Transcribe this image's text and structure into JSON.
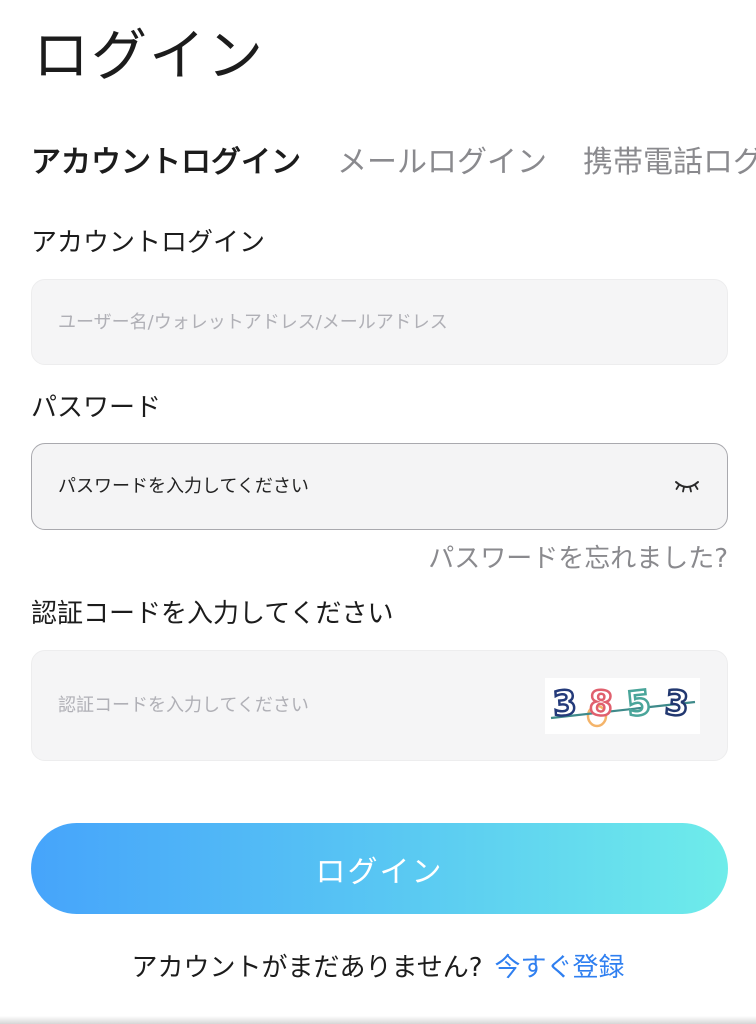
{
  "page": {
    "title": "ログイン"
  },
  "tabs": [
    {
      "label": "アカウントログイン",
      "active": true
    },
    {
      "label": "メールログイン",
      "active": false
    },
    {
      "label": "携帯電話ログイン",
      "active": false
    }
  ],
  "account": {
    "label": "アカウントログイン",
    "placeholder": "ユーザー名/ウォレットアドレス/メールアドレス",
    "value": ""
  },
  "password": {
    "label": "パスワード",
    "placeholder": "パスワードを入力してください",
    "value": "",
    "toggle_icon": "eye-closed-icon",
    "forgot_label": "パスワードを忘れました?"
  },
  "captcha": {
    "label": "認証コードを入力してください",
    "placeholder": "認証コードを入力してください",
    "value": "",
    "image_code": "3853"
  },
  "actions": {
    "login_label": "ログイン",
    "no_account_text": "アカウントがまだありません?",
    "register_label": "今すぐ登録"
  },
  "colors": {
    "accent_link": "#2f7ff0",
    "button_gradient_start": "#46a4fb",
    "button_gradient_end": "#6eecea",
    "input_bg": "#f5f5f6",
    "muted_text": "#8a8a8e"
  }
}
